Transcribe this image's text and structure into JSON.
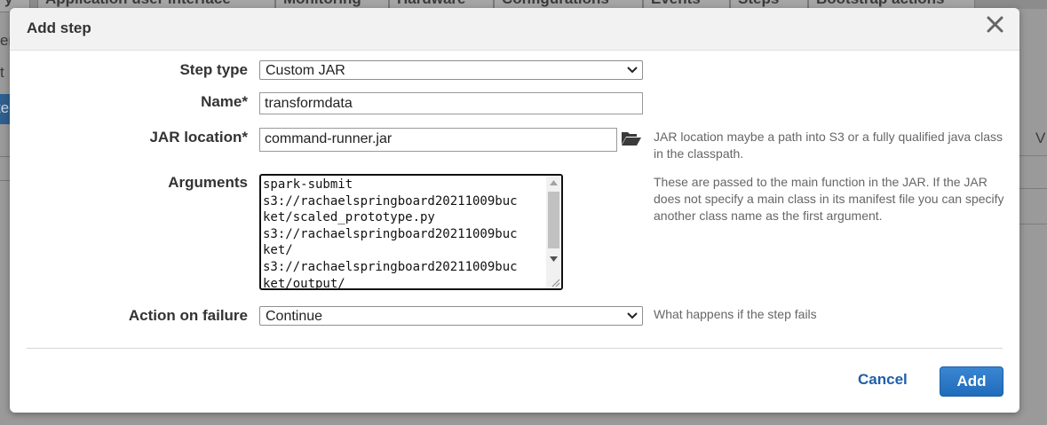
{
  "background": {
    "tabs": [
      "y",
      "Application user interface",
      "Monitoring",
      "Hardware",
      "Configurations",
      "Events",
      "Steps",
      "Bootstrap actions"
    ],
    "left_fragments": [
      "er",
      "t",
      "te"
    ],
    "right_fragment": "V"
  },
  "dialog": {
    "title": "Add step",
    "close_label": "×"
  },
  "form": {
    "step_type": {
      "label": "Step type",
      "value": "Custom JAR"
    },
    "name": {
      "label": "Name*",
      "value": "transformdata"
    },
    "jar_location": {
      "label": "JAR location*",
      "value": "command-runner.jar",
      "help": "JAR location maybe a path into S3 or a fully qualified java class in the classpath."
    },
    "arguments": {
      "label": "Arguments",
      "lines": [
        "spark-submit",
        "s3://rachaelspringboard20211009buc",
        "ket/scaled_prototype.py",
        "s3://rachaelspringboard20211009buc",
        "ket/",
        "s3://rachaelspringboard20211009buc",
        "ket/output/"
      ],
      "help": "These are passed to the main function in the JAR. If the JAR does not specify a main class in its manifest file you can specify another class name as the first argument."
    },
    "action_on_failure": {
      "label": "Action on failure",
      "value": "Continue",
      "help": "What happens if the step fails"
    }
  },
  "footer": {
    "cancel_label": "Cancel",
    "add_label": "Add"
  },
  "colors": {
    "primary_button": "#1f6cbc",
    "link": "#1f5faa",
    "overlay": "#9a9a9a"
  }
}
